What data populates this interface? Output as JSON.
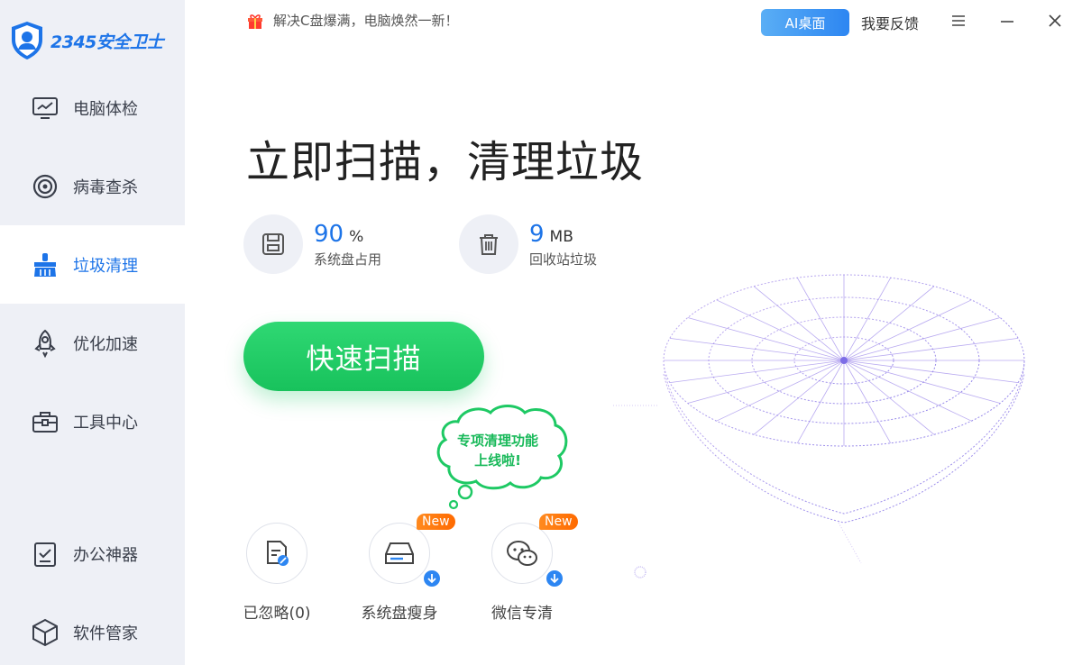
{
  "app": {
    "logo_text": "2345安全卫士"
  },
  "sidebar": {
    "items": [
      {
        "label": "电脑体检",
        "icon": "monitor-icon"
      },
      {
        "label": "病毒查杀",
        "icon": "target-icon"
      },
      {
        "label": "垃圾清理",
        "icon": "broom-icon",
        "active": true
      },
      {
        "label": "优化加速",
        "icon": "rocket-icon"
      },
      {
        "label": "工具中心",
        "icon": "toolbox-icon"
      },
      {
        "label": "办公神器",
        "icon": "checklist-icon"
      },
      {
        "label": "软件管家",
        "icon": "cube-icon"
      }
    ]
  },
  "topbar": {
    "promo": "解决C盘爆满，电脑焕然一新！",
    "ai_button": "AI桌面",
    "feedback": "我要反馈"
  },
  "main": {
    "headline": "立即扫描，清理垃圾",
    "stats": [
      {
        "value": "90",
        "unit": "%",
        "label": "系统盘占用",
        "icon": "disk-icon"
      },
      {
        "value": "9",
        "unit": "MB",
        "label": "回收站垃圾",
        "icon": "trash-icon"
      }
    ],
    "scan_button": "快速扫描",
    "bubble_line1": "专项清理功能",
    "bubble_line2": "上线啦!",
    "tools": [
      {
        "label": "已忽略(0)",
        "icon": "ignored-file-icon"
      },
      {
        "label": "系统盘瘦身",
        "icon": "drive-icon",
        "badge": "New"
      },
      {
        "label": "微信专清",
        "icon": "wechat-icon",
        "badge": "New"
      }
    ]
  },
  "colors": {
    "accent": "#1d74e8",
    "green": "#1ec964",
    "sidebar_bg": "#eef0f6",
    "badge": "#ff7a0f"
  }
}
